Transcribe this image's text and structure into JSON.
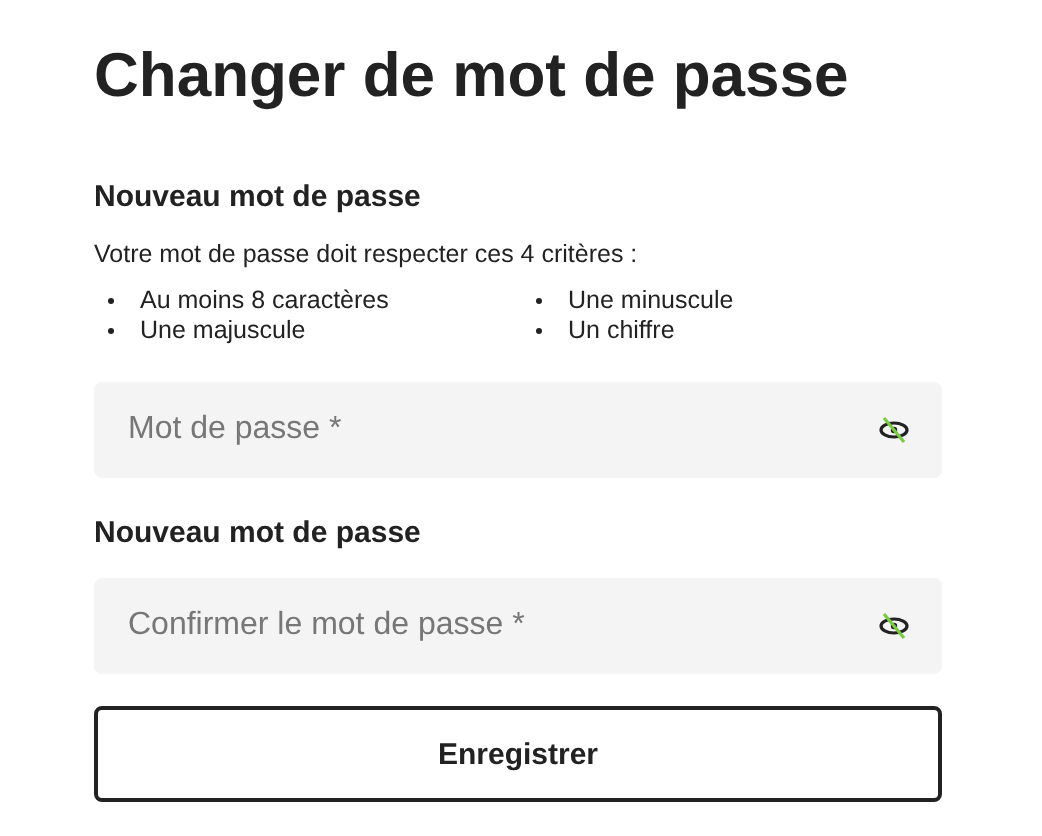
{
  "title": "Changer de mot de passe",
  "section": {
    "heading": "Nouveau mot de passe",
    "intro": "Votre mot de passe doit respecter ces 4 critères :",
    "criteria": [
      "Au moins 8 caractères",
      "Une minuscule",
      "Une majuscule",
      "Un chiffre"
    ]
  },
  "password_field": {
    "placeholder": "Mot de passe *"
  },
  "confirm_heading": "Nouveau mot de passe",
  "confirm_field": {
    "placeholder": "Confirmer le mot de passe *"
  },
  "submit_button": "Enregistrer"
}
